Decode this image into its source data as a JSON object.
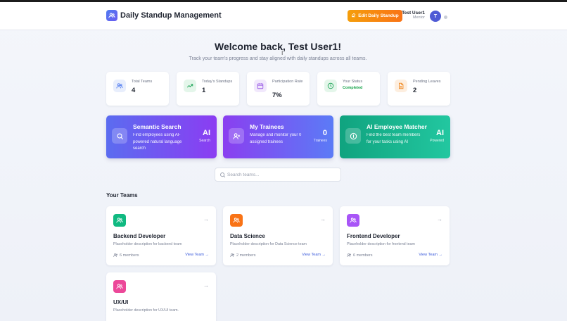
{
  "header": {
    "app_title": "Daily Standup Management",
    "logo_icon": "users-icon",
    "edit_button_label": "Edit Daily Standup",
    "user_name": "Test User1",
    "user_role": "Mentor",
    "avatar_initial": "T"
  },
  "welcome": {
    "title": "Welcome back, Test User1!",
    "subtitle": "Track your team's progress and stay aligned with daily standups across all teams."
  },
  "stats": [
    {
      "label": "Total Teams",
      "value": "4",
      "icon": "users-icon",
      "color": "#4f7bf0"
    },
    {
      "label": "Today's Standups",
      "value": "1",
      "icon": "trending-up-icon",
      "color": "#22a55b"
    },
    {
      "label": "Participation Rate",
      "value": "7%",
      "icon": "calendar-icon",
      "color": "#9b5de5"
    },
    {
      "label": "Your Status",
      "value": "Completed",
      "icon": "clock-icon",
      "color": "#22a55b"
    },
    {
      "label": "Pending Leaves",
      "value": "2",
      "icon": "document-icon",
      "color": "#f08a24"
    }
  ],
  "features": [
    {
      "title": "Semantic Search",
      "description": "Find employees using AI-powered natural language search",
      "big": "AI",
      "small": "Search",
      "icon": "search-icon",
      "gradient": [
        "#5b6cf0",
        "#8b3df2"
      ]
    },
    {
      "title": "My Trainees",
      "description": "Manage and monitor your 0 assigned trainees",
      "big": "0",
      "small": "Trainees",
      "icon": "user-plus-icon",
      "gradient": [
        "#8a3ff0",
        "#5b7bf6"
      ]
    },
    {
      "title": "AI Employee Matcher",
      "description": "Find the best team members for your tasks using AI",
      "big": "AI",
      "small": "Powered",
      "icon": "match-icon",
      "gradient": [
        "#10a37f",
        "#22c7a0"
      ]
    }
  ],
  "search": {
    "placeholder": "Search teams..."
  },
  "teams_section_title": "Your Teams",
  "teams": [
    {
      "name": "Backend Developer",
      "description": "Placeholder description for backend team",
      "members": "6 members",
      "link": "View Team →",
      "color": "#10b981"
    },
    {
      "name": "Data Science",
      "description": "Placeholder description for Data Science team",
      "members": "2 members",
      "link": "View Team →",
      "color": "#f97316"
    },
    {
      "name": "Frontend Developer",
      "description": "Placeholder description for frontend team",
      "members": "6 members",
      "link": "View Team →",
      "color": "#a855f7"
    },
    {
      "name": "UX/UI",
      "description": "Placeholder description for UX/UI team.",
      "members": "",
      "link": "",
      "color": "#ec4899"
    }
  ]
}
